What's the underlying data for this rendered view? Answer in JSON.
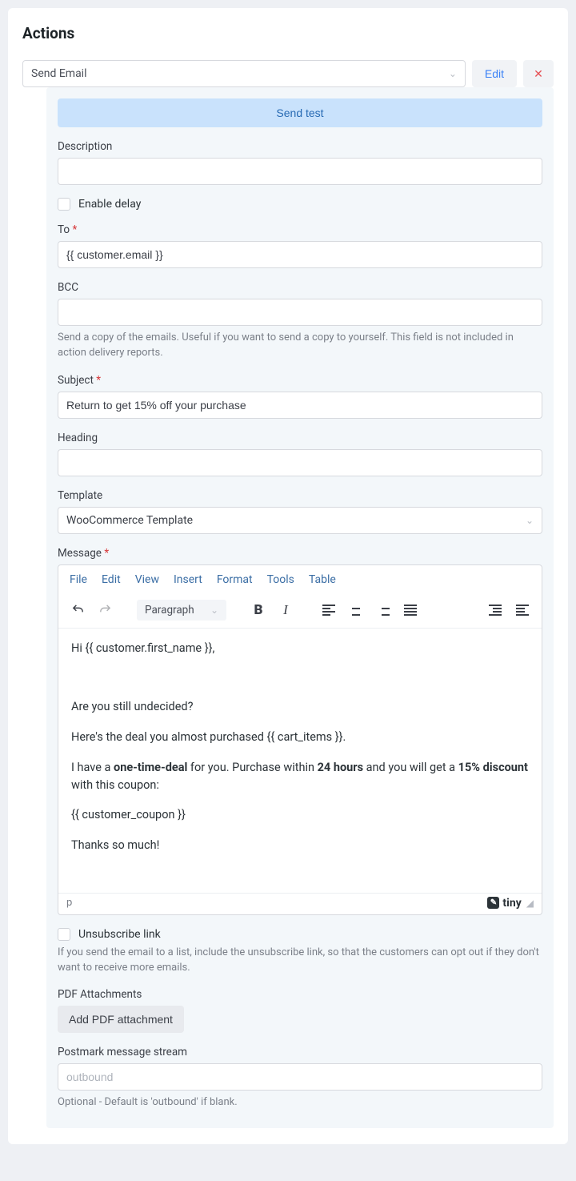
{
  "title": "Actions",
  "top": {
    "select_value": "Send Email",
    "edit": "Edit"
  },
  "panel": {
    "send_test": "Send test",
    "description_label": "Description",
    "description_value": "",
    "enable_delay": "Enable delay",
    "to_label": "To",
    "to_value": "{{ customer.email }}",
    "bcc_label": "BCC",
    "bcc_value": "",
    "bcc_help": "Send a copy of the emails. Useful if you want to send a copy to yourself. This field is not included in action delivery reports.",
    "subject_label": "Subject",
    "subject_value": "Return to get 15% off your purchase",
    "heading_label": "Heading",
    "heading_value": "",
    "template_label": "Template",
    "template_value": "WooCommerce Template",
    "message_label": "Message",
    "unsubscribe_label": "Unsubscribe link",
    "unsubscribe_help": "If you send the email to a list, include the unsubscribe link, so that the customers can opt out if they don't want to receive more emails.",
    "pdf_label": "PDF Attachments",
    "add_pdf": "Add PDF attachment",
    "postmark_label": "Postmark message stream",
    "postmark_placeholder": "outbound",
    "postmark_value": "",
    "postmark_help": "Optional - Default is 'outbound' if blank."
  },
  "editor": {
    "menu": {
      "file": "File",
      "edit": "Edit",
      "view": "View",
      "insert": "Insert",
      "format": "Format",
      "tools": "Tools",
      "table": "Table"
    },
    "block_style": "Paragraph",
    "path": "p",
    "brand": "tiny",
    "body": {
      "l1": "Hi {{ customer.first_name }},",
      "l2": "Are you still undecided?",
      "l3": "Here's the deal you almost purchased {{ cart_items }}.",
      "l4a": "I have a ",
      "l4b": "one-time-deal",
      "l4c": " for you. Purchase within ",
      "l4d": "24 hours",
      "l4e": " and you will get a ",
      "l4f": "15% discount",
      "l4g": " with this coupon:",
      "l5": "{{ customer_coupon }}",
      "l6": "Thanks so much!"
    }
  }
}
